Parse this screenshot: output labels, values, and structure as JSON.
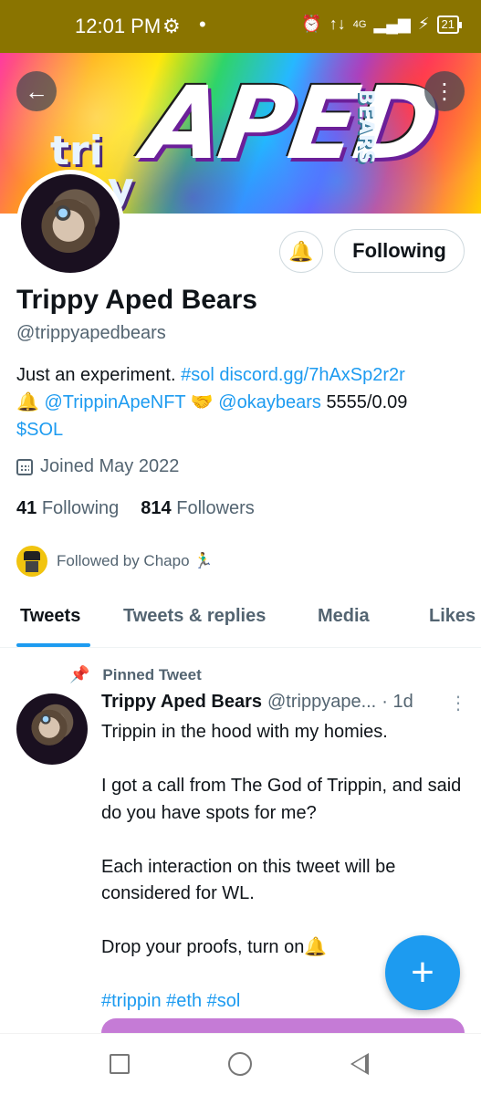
{
  "status_bar": {
    "time": "12:01 PM",
    "settings_icon": "gear-icon",
    "dot": "•",
    "alarm_icon": "alarm-icon",
    "data_icon": "↑↓",
    "network": "4G",
    "charging_icon": "⚡",
    "battery": "21"
  },
  "banner": {
    "logo_main": "APED",
    "logo_small": "tri ppy",
    "logo_side": "BEARS",
    "back_icon": "arrow-left-icon",
    "more_icon": "more-vertical-icon"
  },
  "profile": {
    "name": "Trippy Aped Bears",
    "handle": "@trippyapedbears",
    "follow_button": "Following",
    "bell_icon": "notification-bell-icon",
    "bio": {
      "text1": "Just an experiment. ",
      "hashtag_sol": "#sol",
      "text2": " ",
      "discord_link": "discord.gg/7hAxSp2r2r",
      "bell_emoji": "🔔",
      "mention1": "@TrippinApeNFT",
      "handshake_emoji": "🤝",
      "mention2": "@okaybears",
      "supply_price": "5555/0.09",
      "cashtag": "$SOL"
    },
    "joined": "Joined May 2022",
    "following_count": "41",
    "following_label": "Following",
    "followers_count": "814",
    "followers_label": "Followers",
    "followed_by": "Followed by Chapo 🏃‍♂️"
  },
  "tabs": [
    {
      "label": "Tweets",
      "active": true
    },
    {
      "label": "Tweets & replies",
      "active": false
    },
    {
      "label": "Media",
      "active": false
    },
    {
      "label": "Likes",
      "active": false
    }
  ],
  "pinned_tweet": {
    "pinned_label": "Pinned Tweet",
    "author_name": "Trippy Aped Bears",
    "author_handle": "@trippyape...",
    "time": "· 1d",
    "more_icon": "⋮",
    "line1": "Trippin in the hood with my homies.",
    "line2": "I got a call from The God of Trippin, and said do you have spots for me?",
    "line3": "Each interaction on this tweet will be considered for WL.",
    "line4": "Drop your proofs, turn on🔔",
    "hashtags": "#trippin #eth #sol"
  },
  "fab": {
    "label": "+"
  },
  "colors": {
    "accent": "#1d9bf0",
    "status_bar": "#8a7400",
    "muted_text": "#536471"
  }
}
